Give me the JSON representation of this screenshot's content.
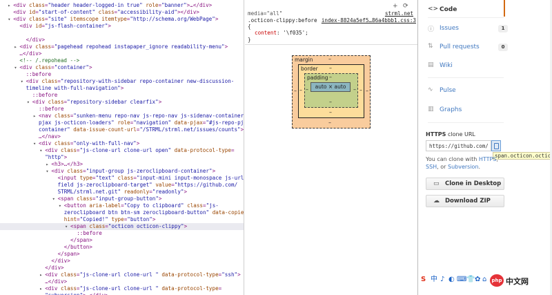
{
  "elements": {
    "lines": [
      {
        "indent": 2,
        "arrow": "▸",
        "parts": [
          [
            "tg",
            "<div "
          ],
          [
            "an",
            "class"
          ],
          [
            "tg",
            "="
          ],
          [
            "av",
            "\"header header-logged-in true\""
          ],
          [
            "tg",
            " "
          ],
          [
            "an",
            "role"
          ],
          [
            "tg",
            "="
          ],
          [
            "av",
            "\"banner\""
          ],
          [
            "tg",
            ">…</div>"
          ]
        ]
      },
      {
        "indent": 2,
        "arrow": "",
        "parts": [
          [
            "tg",
            "<div "
          ],
          [
            "an",
            "id"
          ],
          [
            "tg",
            "="
          ],
          [
            "av",
            "\"start-of-content\""
          ],
          [
            "tg",
            " "
          ],
          [
            "an",
            "class"
          ],
          [
            "tg",
            "="
          ],
          [
            "av",
            "\"accessibility-aid\""
          ],
          [
            "tg",
            "></div>"
          ]
        ]
      },
      {
        "indent": 2,
        "arrow": "▾",
        "parts": [
          [
            "tg",
            "<div "
          ],
          [
            "an",
            "class"
          ],
          [
            "tg",
            "="
          ],
          [
            "av",
            "\"site\""
          ],
          [
            "tg",
            " "
          ],
          [
            "an",
            "itemscope itemtype"
          ],
          [
            "tg",
            "="
          ],
          [
            "av",
            "\"http://schema.org/WebPage\""
          ],
          [
            "tg",
            ">"
          ]
        ]
      },
      {
        "indent": 4,
        "arrow": "",
        "parts": [
          [
            "tg",
            "<div "
          ],
          [
            "an",
            "id"
          ],
          [
            "tg",
            "="
          ],
          [
            "av",
            "\"js-flash-container\""
          ],
          [
            "tg",
            ">"
          ]
        ]
      },
      {
        "indent": 0,
        "arrow": "",
        "parts": [
          [
            "tg",
            ""
          ]
        ]
      },
      {
        "indent": 6,
        "arrow": "",
        "parts": [
          [
            "tg",
            "</div>"
          ]
        ]
      },
      {
        "indent": 4,
        "arrow": "▸",
        "parts": [
          [
            "tg",
            "<div "
          ],
          [
            "an",
            "class"
          ],
          [
            "tg",
            "="
          ],
          [
            "av",
            "\"pagehead repohead instapaper_ignore readability-menu\""
          ],
          [
            "tg",
            ">"
          ]
        ]
      },
      {
        "indent": 4,
        "arrow": "",
        "parts": [
          [
            "tg",
            "…</div>"
          ]
        ]
      },
      {
        "indent": 4,
        "arrow": "",
        "parts": [
          [
            "cm",
            "<!-- /.repohead -->"
          ]
        ]
      },
      {
        "indent": 4,
        "arrow": "▾",
        "parts": [
          [
            "tg",
            "<div "
          ],
          [
            "an",
            "class"
          ],
          [
            "tg",
            "="
          ],
          [
            "av",
            "\"container\""
          ],
          [
            "tg",
            ">"
          ]
        ]
      },
      {
        "indent": 6,
        "arrow": "",
        "parts": [
          [
            "ps",
            "::before"
          ]
        ]
      },
      {
        "indent": 6,
        "arrow": "▾",
        "parts": [
          [
            "tg",
            "<div "
          ],
          [
            "an",
            "class"
          ],
          [
            "tg",
            "="
          ],
          [
            "av",
            "\"repository-with-sidebar repo-container new-discussion-"
          ]
        ]
      },
      {
        "indent": 6,
        "arrow": "",
        "parts": [
          [
            "av",
            "timeline with-full-navigation\""
          ],
          [
            "tg",
            ">"
          ]
        ]
      },
      {
        "indent": 8,
        "arrow": "",
        "parts": [
          [
            "ps",
            "::before"
          ]
        ]
      },
      {
        "indent": 8,
        "arrow": "▾",
        "parts": [
          [
            "tg",
            "<div "
          ],
          [
            "an",
            "class"
          ],
          [
            "tg",
            "="
          ],
          [
            "av",
            "\"repository-sidebar clearfix\""
          ],
          [
            "tg",
            ">"
          ]
        ]
      },
      {
        "indent": 10,
        "arrow": "",
        "parts": [
          [
            "ps",
            "::before"
          ]
        ]
      },
      {
        "indent": 10,
        "arrow": "▸",
        "parts": [
          [
            "tg",
            "<nav "
          ],
          [
            "an",
            "class"
          ],
          [
            "tg",
            "="
          ],
          [
            "av",
            "\"sunken-menu repo-nav js-repo-nav js-sidenav-container-"
          ]
        ]
      },
      {
        "indent": 10,
        "arrow": "",
        "parts": [
          [
            "av",
            "pjax js-octicon-loaders\""
          ],
          [
            "tg",
            " "
          ],
          [
            "an",
            "role"
          ],
          [
            "tg",
            "="
          ],
          [
            "av",
            "\"navigation\""
          ],
          [
            "tg",
            " "
          ],
          [
            "an",
            "data-pjax"
          ],
          [
            "tg",
            "="
          ],
          [
            "av",
            "\"#js-repo-pjax-"
          ]
        ]
      },
      {
        "indent": 10,
        "arrow": "",
        "parts": [
          [
            "av",
            "container\""
          ],
          [
            "tg",
            " "
          ],
          [
            "an",
            "data-issue-count-url"
          ],
          [
            "tg",
            "="
          ],
          [
            "av",
            "\"/STRML/strml.net/issues/counts\""
          ],
          [
            "tg",
            ">"
          ]
        ]
      },
      {
        "indent": 10,
        "arrow": "",
        "parts": [
          [
            "tg",
            "…</nav>"
          ]
        ]
      },
      {
        "indent": 10,
        "arrow": "▾",
        "parts": [
          [
            "tg",
            "<div "
          ],
          [
            "an",
            "class"
          ],
          [
            "tg",
            "="
          ],
          [
            "av",
            "\"only-with-full-nav\""
          ],
          [
            "tg",
            ">"
          ]
        ]
      },
      {
        "indent": 12,
        "arrow": "▾",
        "parts": [
          [
            "tg",
            "<div "
          ],
          [
            "an",
            "class"
          ],
          [
            "tg",
            "="
          ],
          [
            "av",
            "\"js-clone-url clone-url open\""
          ],
          [
            "tg",
            " "
          ],
          [
            "an",
            "data-protocol-type"
          ],
          [
            "tg",
            "="
          ]
        ]
      },
      {
        "indent": 12,
        "arrow": "",
        "parts": [
          [
            "av",
            "\"http\""
          ],
          [
            "tg",
            ">"
          ]
        ]
      },
      {
        "indent": 14,
        "arrow": "▸",
        "parts": [
          [
            "tg",
            "<h3>…</h3>"
          ]
        ]
      },
      {
        "indent": 14,
        "arrow": "▾",
        "parts": [
          [
            "tg",
            "<div "
          ],
          [
            "an",
            "class"
          ],
          [
            "tg",
            "="
          ],
          [
            "av",
            "\"input-group js-zeroclipboard-container\""
          ],
          [
            "tg",
            ">"
          ]
        ]
      },
      {
        "indent": 16,
        "arrow": "",
        "parts": [
          [
            "tg",
            "<input "
          ],
          [
            "an",
            "type"
          ],
          [
            "tg",
            "="
          ],
          [
            "av",
            "\"text\""
          ],
          [
            "tg",
            " "
          ],
          [
            "an",
            "class"
          ],
          [
            "tg",
            "="
          ],
          [
            "av",
            "\"input-mini input-monospace js-url-"
          ]
        ]
      },
      {
        "indent": 16,
        "arrow": "",
        "parts": [
          [
            "av",
            "field js-zeroclipboard-target\""
          ],
          [
            "tg",
            " "
          ],
          [
            "an",
            "value"
          ],
          [
            "tg",
            "="
          ],
          [
            "av",
            "\"https://github.com/"
          ]
        ]
      },
      {
        "indent": 16,
        "arrow": "",
        "parts": [
          [
            "av",
            "STRML/strml.net.git\""
          ],
          [
            "tg",
            " "
          ],
          [
            "an",
            "readonly"
          ],
          [
            "tg",
            "="
          ],
          [
            "av",
            "\"readonly\""
          ],
          [
            "tg",
            ">"
          ]
        ]
      },
      {
        "indent": 16,
        "arrow": "▾",
        "parts": [
          [
            "tg",
            "<span "
          ],
          [
            "an",
            "class"
          ],
          [
            "tg",
            "="
          ],
          [
            "av",
            "\"input-group-button\""
          ],
          [
            "tg",
            ">"
          ]
        ]
      },
      {
        "indent": 18,
        "arrow": "▾",
        "parts": [
          [
            "tg",
            "<button "
          ],
          [
            "an",
            "aria-label"
          ],
          [
            "tg",
            "="
          ],
          [
            "av",
            "\"Copy to clipboard\""
          ],
          [
            "tg",
            " "
          ],
          [
            "an",
            "class"
          ],
          [
            "tg",
            "="
          ],
          [
            "av",
            "\"js-"
          ]
        ]
      },
      {
        "indent": 18,
        "arrow": "",
        "parts": [
          [
            "av",
            "zeroclipboard btn btn-sm zeroclipboard-button\""
          ],
          [
            "tg",
            " "
          ],
          [
            "an",
            "data-copied-"
          ]
        ]
      },
      {
        "indent": 18,
        "arrow": "",
        "parts": [
          [
            "an",
            "hint"
          ],
          [
            "tg",
            "="
          ],
          [
            "av",
            "\"Copied!\""
          ],
          [
            "tg",
            " "
          ],
          [
            "an",
            "type"
          ],
          [
            "tg",
            "="
          ],
          [
            "av",
            "\"button\""
          ],
          [
            "tg",
            ">"
          ]
        ]
      },
      {
        "indent": 20,
        "arrow": "▾",
        "parts": [
          [
            "tg",
            "<span "
          ],
          [
            "an",
            "class"
          ],
          [
            "tg",
            "="
          ],
          [
            "av",
            "\"octicon octicon-clippy\""
          ],
          [
            "tg",
            ">"
          ]
        ],
        "selected": true
      },
      {
        "indent": 22,
        "arrow": "",
        "parts": [
          [
            "ps",
            "::before"
          ]
        ]
      },
      {
        "indent": 20,
        "arrow": "",
        "parts": [
          [
            "tg",
            "</span>"
          ]
        ]
      },
      {
        "indent": 18,
        "arrow": "",
        "parts": [
          [
            "tg",
            "</button>"
          ]
        ]
      },
      {
        "indent": 16,
        "arrow": "",
        "parts": [
          [
            "tg",
            "</span>"
          ]
        ]
      },
      {
        "indent": 14,
        "arrow": "",
        "parts": [
          [
            "tg",
            "</div>"
          ]
        ]
      },
      {
        "indent": 12,
        "arrow": "",
        "parts": [
          [
            "tg",
            "</div>"
          ]
        ]
      },
      {
        "indent": 12,
        "arrow": "▸",
        "parts": [
          [
            "tg",
            "<div "
          ],
          [
            "an",
            "class"
          ],
          [
            "tg",
            "="
          ],
          [
            "av",
            "\"js-clone-url clone-url \""
          ],
          [
            "tg",
            " "
          ],
          [
            "an",
            "data-protocol-type"
          ],
          [
            "tg",
            "="
          ],
          [
            "av",
            "\"ssh\""
          ],
          [
            "tg",
            ">"
          ]
        ]
      },
      {
        "indent": 12,
        "arrow": "",
        "parts": [
          [
            "tg",
            "…</div>"
          ]
        ]
      },
      {
        "indent": 12,
        "arrow": "▸",
        "parts": [
          [
            "tg",
            "<div "
          ],
          [
            "an",
            "class"
          ],
          [
            "tg",
            "="
          ],
          [
            "av",
            "\"js-clone-url clone-url \""
          ],
          [
            "tg",
            " "
          ],
          [
            "an",
            "data-protocol-type"
          ],
          [
            "tg",
            "="
          ]
        ]
      },
      {
        "indent": 12,
        "arrow": "",
        "parts": [
          [
            "av",
            "\"subversion\""
          ],
          [
            "tg",
            ">…</div>"
          ]
        ]
      },
      {
        "indent": 12,
        "arrow": "▸",
        "parts": [
          [
            "tg",
            "<div "
          ],
          [
            "an",
            "class"
          ],
          [
            "tg",
            "="
          ],
          [
            "av",
            "\"clone-options\""
          ],
          [
            "tg",
            ">…</div>"
          ]
        ]
      }
    ]
  },
  "styles": {
    "media": "media=\"all\"",
    "source_a": "strml.net",
    "selector": ".octicon-clippy:before",
    "source_b": "index-8824a5ef5…86a4bbb1.css:3",
    "brace_open": "{",
    "prop_name": "content",
    "prop_value": "'\\f035';",
    "brace_close": "}",
    "add_icon": "+",
    "toggle_icon": "⟳",
    "box_model": {
      "margin_label": "margin",
      "border_label": "border",
      "padding_label": "padding",
      "content": "auto × auto",
      "dash": "–"
    }
  },
  "webpage": {
    "nav": [
      {
        "label": "Code",
        "icon": "<>",
        "icon_name": "code-icon",
        "active": true,
        "badge": ""
      },
      {
        "label": "Issues",
        "icon": "ⓘ",
        "icon_name": "issue-icon",
        "active": false,
        "badge": "1"
      },
      {
        "label": "Pull requests",
        "icon": "⇅",
        "icon_name": "pull-request-icon",
        "active": false,
        "badge": "0"
      },
      {
        "label": "Wiki",
        "icon": "▤",
        "icon_name": "book-icon",
        "active": false,
        "badge": ""
      },
      {
        "label": "Pulse",
        "icon": "∿",
        "icon_name": "pulse-icon",
        "active": false,
        "badge": ""
      },
      {
        "label": "Graphs",
        "icon": "▥",
        "icon_name": "graph-icon",
        "active": false,
        "badge": ""
      }
    ],
    "https_label_bold": "HTTPS",
    "https_label_rest": " clone URL",
    "clone_url": "https://github.com/STRML/strml.net.git",
    "tooltip": "span.octicon.octicon-clippy",
    "clone_note_prefix": "You can clone with ",
    "clone_note_https": "HTTPS",
    "clone_note_sep": ",",
    "clone_note_ssh": "SSH",
    "clone_note_mid": ", or ",
    "clone_note_svn": "Subversion",
    "clone_note_end": ".",
    "clone_desktop": "Clone in Desktop",
    "download_zip": "Download ZIP",
    "tray": {
      "icons": [
        "S",
        "中",
        "♪",
        "◐",
        "⌨",
        "👕",
        "✿",
        "⌂"
      ],
      "logo": "php",
      "site_name": "中文网"
    }
  },
  "colors": {
    "accent_orange": "#d26911",
    "link_blue": "#4078c0",
    "selected_row": "#eaeaf0"
  }
}
